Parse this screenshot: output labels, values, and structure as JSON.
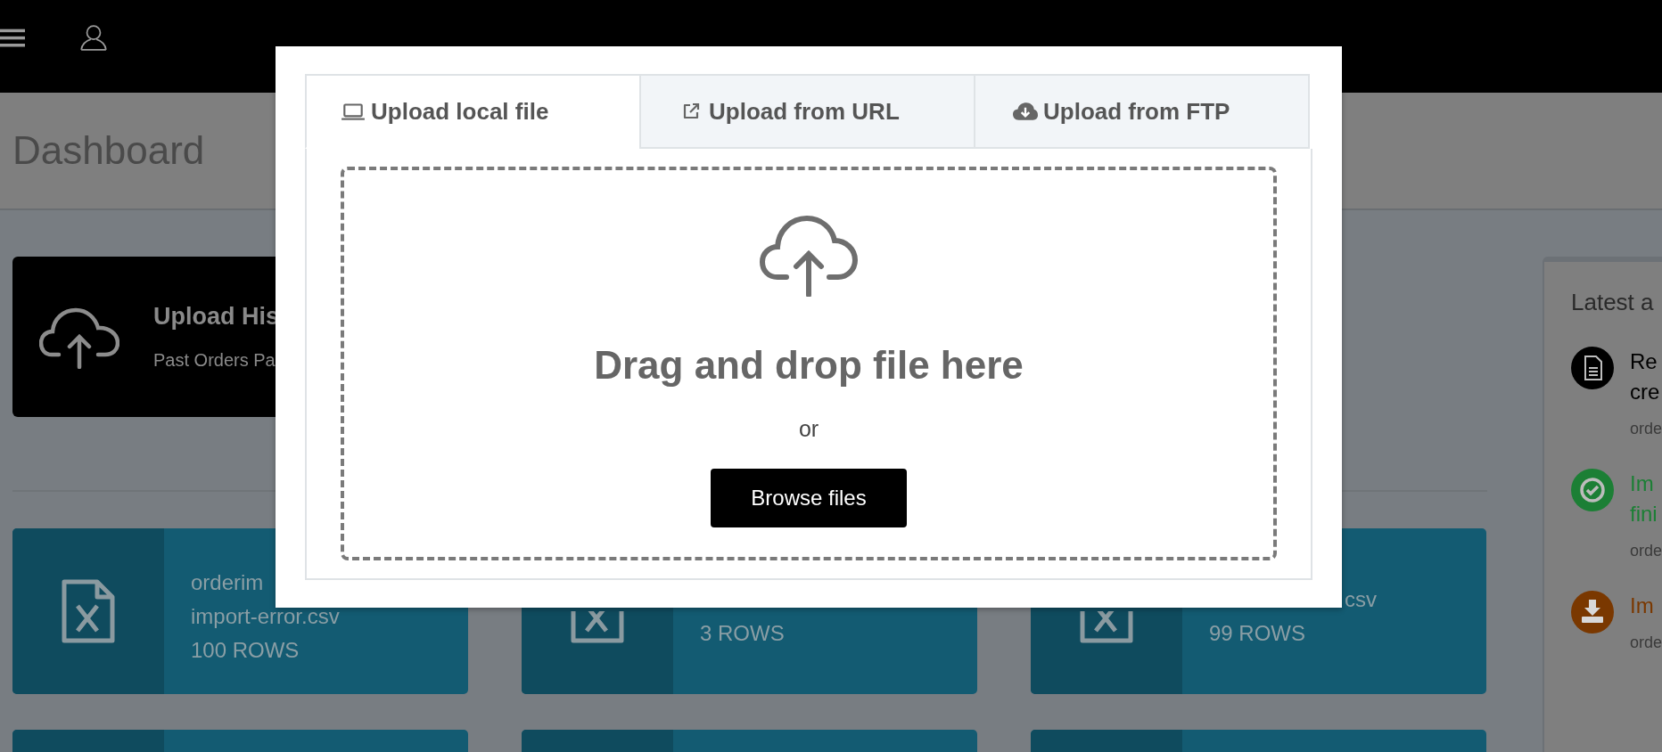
{
  "page_title": "Dashboard",
  "upload_card": {
    "title": "Upload His",
    "subtitle": "Past Orders Pa"
  },
  "files": [
    {
      "kind": "whole",
      "lines": [
        "orderim",
        "import-error.csv",
        "100 ROWS"
      ]
    },
    {
      "kind": "partial",
      "lines": [
        "3 ROWS"
      ]
    },
    {
      "kind": "partial",
      "lines": [
        "csv",
        "99 ROWS"
      ]
    }
  ],
  "activity": {
    "title": "Latest a",
    "items": [
      {
        "title": [
          "Re",
          "cre"
        ],
        "meta": "orde",
        "color": "#000000"
      },
      {
        "title": [
          "Im",
          "fini"
        ],
        "meta": "orde",
        "color": "#1c7f35"
      },
      {
        "title": [
          "Im"
        ],
        "meta": "orde",
        "color": "#7a3800"
      }
    ]
  },
  "modal": {
    "tabs": [
      {
        "label": "Upload local file",
        "selected": true
      },
      {
        "label": "Upload from URL",
        "selected": false
      },
      {
        "label": "Upload from FTP",
        "selected": false
      }
    ],
    "drop_text": "Drag and drop file here",
    "or_text": "or",
    "browse_button": "Browse files"
  }
}
